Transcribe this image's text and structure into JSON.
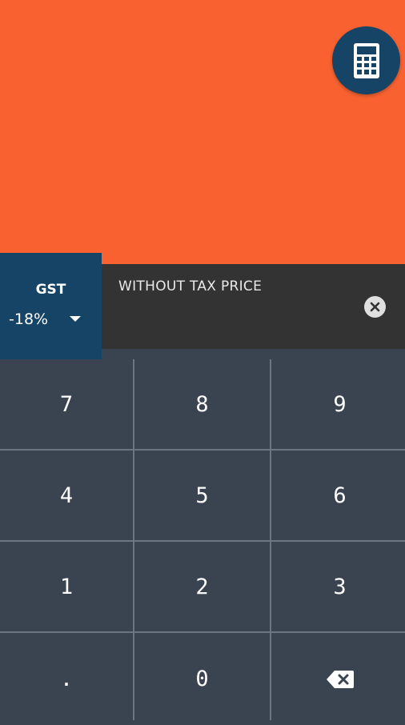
{
  "colors": {
    "accent_orange": "#f96230",
    "navy": "#154466",
    "input_bar": "#333333",
    "keypad_bg": "#3a4450"
  },
  "fab": {
    "icon": "calculator-icon"
  },
  "tax_selector": {
    "title": "GST",
    "value": "-18%",
    "icon": "caret-down-icon"
  },
  "input": {
    "label": "WITHOUT TAX PRICE",
    "clear_icon": "close-circle-icon"
  },
  "keypad": {
    "keys": [
      {
        "label": "7",
        "name": "key-7"
      },
      {
        "label": "8",
        "name": "key-8"
      },
      {
        "label": "9",
        "name": "key-9"
      },
      {
        "label": "4",
        "name": "key-4"
      },
      {
        "label": "5",
        "name": "key-5"
      },
      {
        "label": "6",
        "name": "key-6"
      },
      {
        "label": "1",
        "name": "key-1"
      },
      {
        "label": "2",
        "name": "key-2"
      },
      {
        "label": "3",
        "name": "key-3"
      },
      {
        "label": ".",
        "name": "key-decimal"
      },
      {
        "label": "0",
        "name": "key-0"
      },
      {
        "label": "",
        "name": "backspace-key",
        "icon": "backspace-icon"
      }
    ]
  }
}
